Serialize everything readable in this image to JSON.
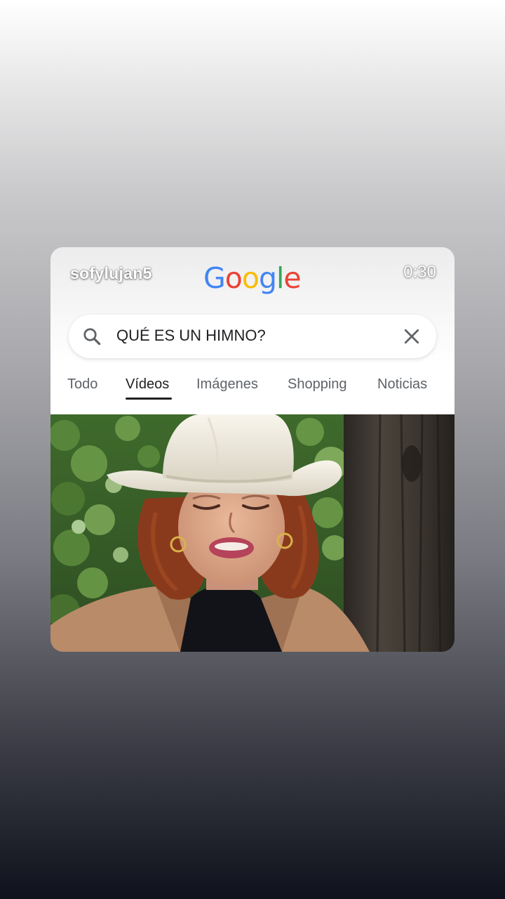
{
  "header": {
    "username": "sofylujan5",
    "timer": "0:30",
    "logo": {
      "letters": [
        "G",
        "o",
        "o",
        "g",
        "l",
        "e"
      ],
      "colors": [
        "#4285F4",
        "#EA4335",
        "#FBBC05",
        "#4285F4",
        "#34A853",
        "#EA4335"
      ]
    }
  },
  "search": {
    "query": "QUÉ ES UN HIMNO?",
    "icon": "search-icon",
    "clear_icon": "close-icon"
  },
  "tabs": [
    {
      "label": "Todo",
      "active": false
    },
    {
      "label": "Vídeos",
      "active": true
    },
    {
      "label": "Imágenes",
      "active": false
    },
    {
      "label": "Shopping",
      "active": false
    },
    {
      "label": "Noticias",
      "active": false
    }
  ],
  "video": {
    "subject": "woman in white cowboy hat",
    "colors": {
      "hat": "#f1ede2",
      "hair": "#8a3a1c",
      "jacket": "#b98b69",
      "shirt": "#111318",
      "foliage": "#4f7a35",
      "post": "#3a3530"
    }
  }
}
